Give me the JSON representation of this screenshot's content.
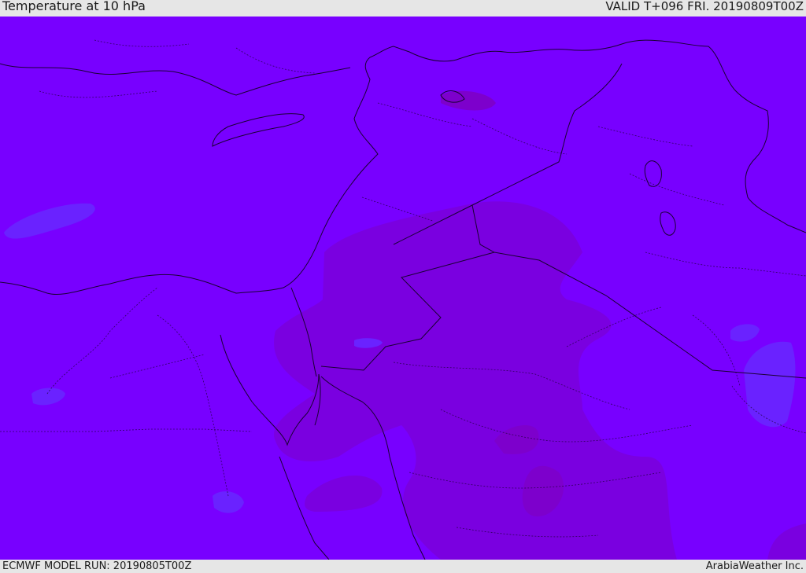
{
  "header": {
    "title": "Temperature at 10 hPa",
    "valid": "VALID T+096 FRI. 20190809T00Z"
  },
  "footer": {
    "model_run": "ECMWF MODEL RUN: 20190805T00Z",
    "credit": "ArabiaWeather Inc."
  },
  "map": {
    "colors": {
      "base_field": "#7800ff",
      "warmer_field": "#7a00e0",
      "warmest_field": "#7d00cc",
      "cooler_field": "#6a22ff",
      "border_line": "#1a0033"
    }
  }
}
